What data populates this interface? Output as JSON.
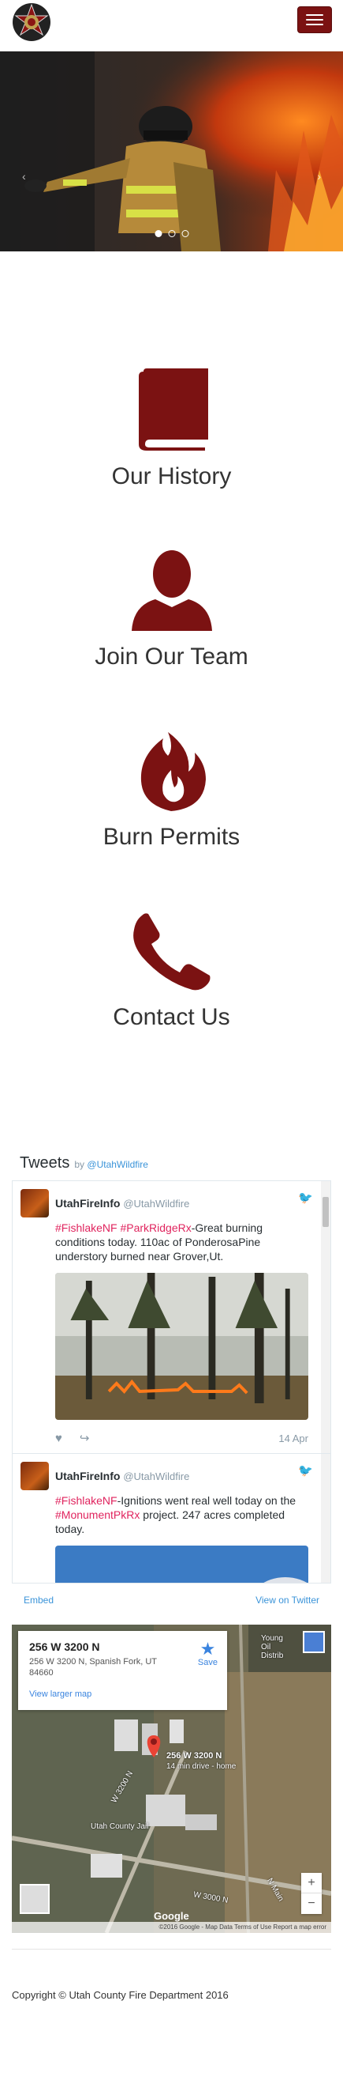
{
  "nav": {
    "logo_icon": "fire-department-badge-icon",
    "menu_icon": "hamburger-icon",
    "brand_color": "#7b1212"
  },
  "hero": {
    "prev_arrow": "‹",
    "next_arrow": "›",
    "slides": 3,
    "active_slide": 1
  },
  "features": [
    {
      "label": "Our History",
      "icon": "book-icon"
    },
    {
      "label": "Join Our Team",
      "icon": "person-icon"
    },
    {
      "label": "Burn Permits",
      "icon": "flame-icon"
    },
    {
      "label": "Contact Us",
      "icon": "phone-icon"
    }
  ],
  "twitter": {
    "title": "Tweets",
    "by": "by",
    "handle_link": "@UtahWildfire",
    "tweets": [
      {
        "name": "UtahFireInfo",
        "handle": "@UtahWildfire",
        "tags": "#FishlakeNF #ParkRidgeRx",
        "text": "-Great burning conditions today. 110ac of PonderosaPine understory burned near Grover,Ut.",
        "date": "14 Apr"
      },
      {
        "name": "UtahFireInfo",
        "handle": "@UtahWildfire",
        "tag1": "#FishlakeNF",
        "text1": "-Ignitions went real well today on the",
        "tag2": "#MonumentPkRx",
        "text2": "project. 247 acres completed today."
      }
    ],
    "embed": "Embed",
    "view_on": "View on Twitter"
  },
  "map": {
    "title": "256 W 3200 N",
    "address": "256 W 3200 N, Spanish Fork, UT 84660",
    "larger_map": "View larger map",
    "save": "Save",
    "pin_label": "256 W 3200 N",
    "pin_sub": "14 min drive - home",
    "road1": "W 3200 N",
    "road2": "Utah County Jail",
    "road3": "W 3000 N",
    "road4": "N Main",
    "road5": "Young Oil Distrib",
    "road6": "Utah County Jail",
    "zoom_in": "+",
    "zoom_out": "−",
    "attribution": "©2016 Google - Map Data   Terms of Use   Report a map error",
    "google": "Google"
  },
  "footer": {
    "copyright": "Copyright © Utah County Fire Department 2016"
  }
}
